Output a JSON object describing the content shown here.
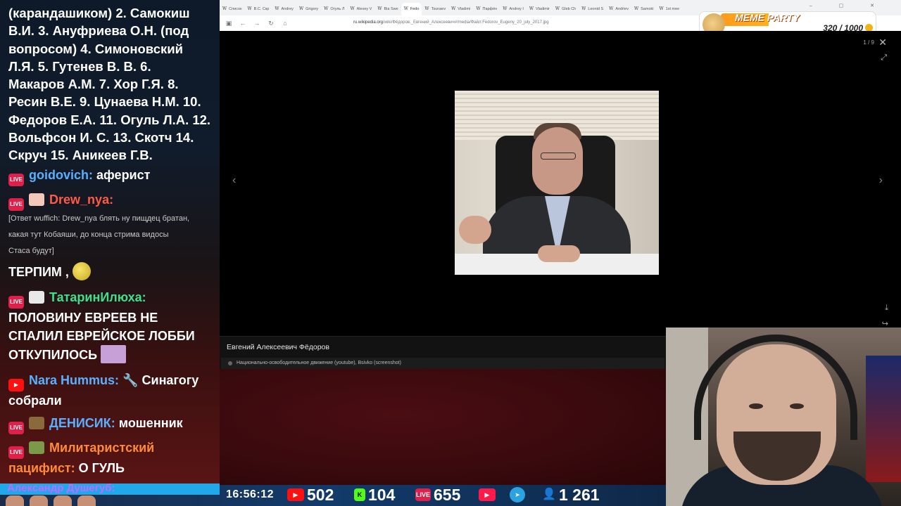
{
  "chat": {
    "top_text_lines": [
      "(карандашиком) 2. Самокиш",
      "В.И. 3. Ануфриева О.Н. (под",
      "вопросом) 4. Симоновский",
      "Л.Я. 5. Гутенев В. В. 6.",
      "Макаров А.М. 7. Хор Г.Я. 8.",
      "Ресин В.Е. 9. Цунаева Н.М. 10.",
      "Федоров Е.А. 11. Огуль Л.А. 12.",
      "Вольфсон И. С. 13. Скотч 14.",
      "Скруч 15. Аникеев Г.В."
    ],
    "messages": [
      {
        "platform": "LIVE",
        "nick": "goidovich:",
        "text": "аферист"
      },
      {
        "platform": "LIVE",
        "nick": "Drew_nya:",
        "text": ""
      },
      {
        "reply_lines": [
          "[Ответ wuffich: Drew_nya блять ну пищдец братан,",
          "какая тут Кобаяши, до конца стрима видосы",
          "Стаса будут]"
        ]
      },
      {
        "text": "ТЕРПИМ ,"
      },
      {
        "platform": "LIVE",
        "nick": "ТатаринИлюха:",
        "text_lines": [
          "ПОЛОВИНУ ЕВРЕЕВ НЕ",
          "СПАЛИЛ ЕВРЕЙСКОЕ ЛОББИ",
          "ОТКУПИЛОСЬ"
        ]
      },
      {
        "platform": "YT",
        "nick": "Nara Hummus:",
        "text": "Синагогу",
        "text2": "собрали"
      },
      {
        "platform": "LIVE",
        "nick": "ДЕНИСИК:",
        "text": "мошенник"
      },
      {
        "platform": "LIVE",
        "nick": "Милитаристский",
        "nick2": "пацифист:",
        "text": "О ГУЛЬ"
      },
      {
        "platform": "LIVE",
        "nick": "Александр Душегуб:"
      }
    ]
  },
  "browser": {
    "tabs": [
      "Список",
      "В.С. Скр",
      "Andrey",
      "Grigory",
      "Огуль Л",
      "Alexey V",
      "Bia Swe",
      "Fedo",
      "Tsunaev",
      "Vladimi",
      "Парфён",
      "Andrey I",
      "Vladimir",
      "Gleb Ch",
      "Leonid S",
      "Andriev",
      "Samoki",
      "1st mee"
    ],
    "active_tab_index": 7,
    "url_host": "ru.wikipedia.org",
    "url_path": "/wiki/Фёдоров,_Евгений_Алексеевич#/media/Файл:Fedorov_Eugeny_20_july_2017.jpg"
  },
  "meme_party": {
    "title": "MEME PARTY",
    "count": "320 / 1000",
    "progress_fraction": 0.32
  },
  "viewer": {
    "counter": "1 / 9",
    "caption_title": "Евгений Алексеевич Фёдоров",
    "credit": "Национально-освободительное движение (youtube), Bsivko (screenshot)"
  },
  "status_bar": {
    "time": "16:56:12",
    "youtube_viewers": "502",
    "kick_viewers": "104",
    "live_viewers": "655",
    "total_viewers": "1 261"
  },
  "colors": {
    "live_badge": "#e0204a",
    "youtube": "#ff1010",
    "kick": "#53fc18",
    "telegram": "#2aa3e0"
  }
}
